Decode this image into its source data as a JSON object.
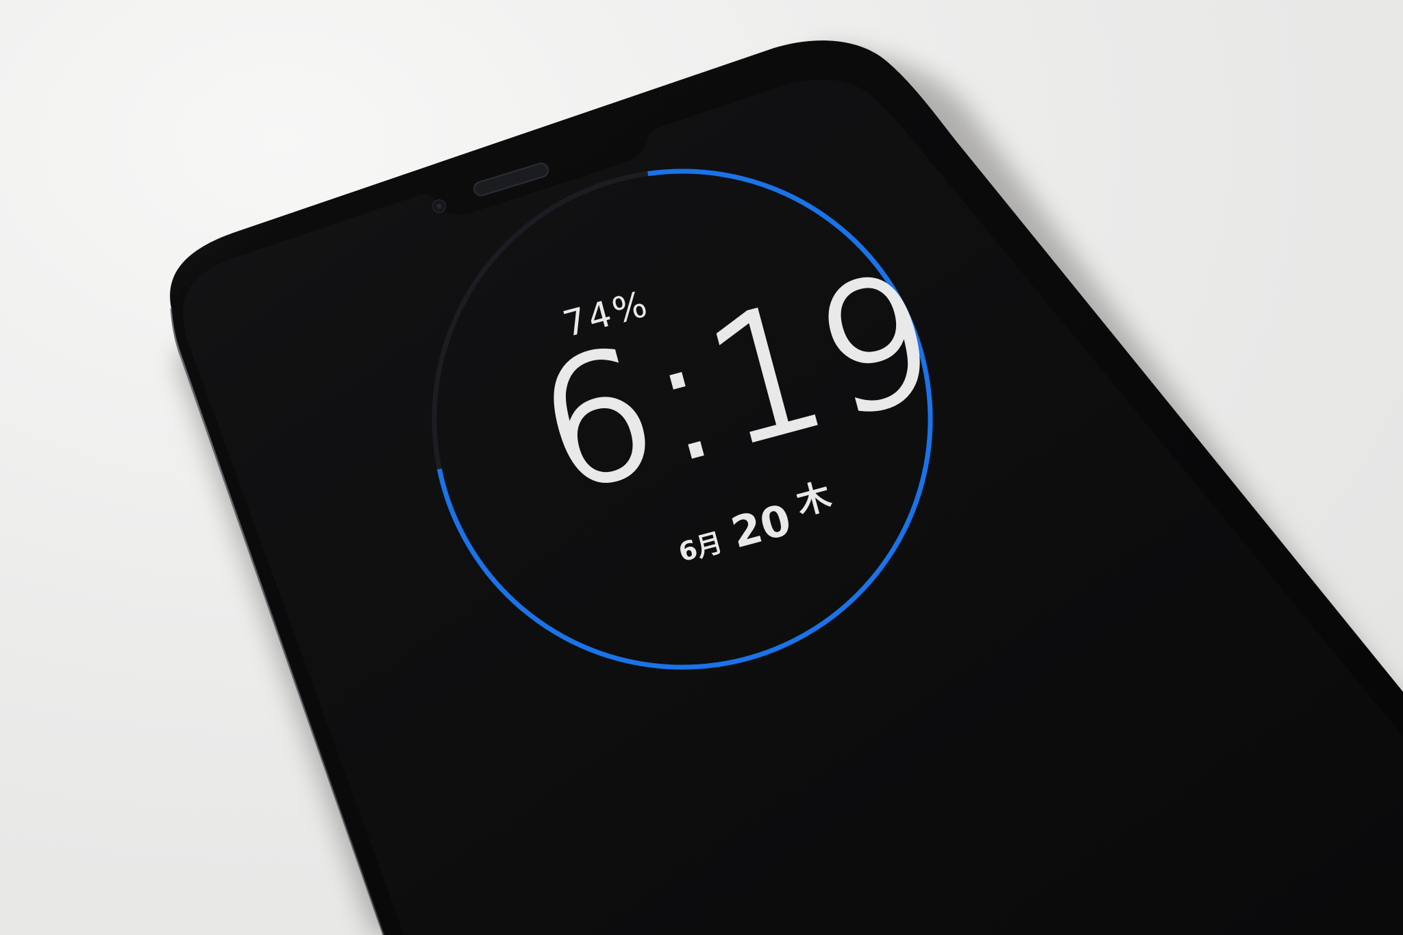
{
  "ambient_display": {
    "battery_percent_label": "74%",
    "battery_level": 0.74,
    "time": "6:19",
    "date": {
      "month": "6月",
      "day": "20",
      "weekday": "木"
    }
  },
  "colors": {
    "background": "#ebebea",
    "phone_body": "#0b0b0c",
    "screen": "#0f0f10",
    "ring_accent": "#1a73e8",
    "ring_track": "#1c1d22",
    "text": "#e9e9e9"
  },
  "icons": {
    "front_camera": "camera-lens",
    "earpiece": "speaker-grille"
  }
}
